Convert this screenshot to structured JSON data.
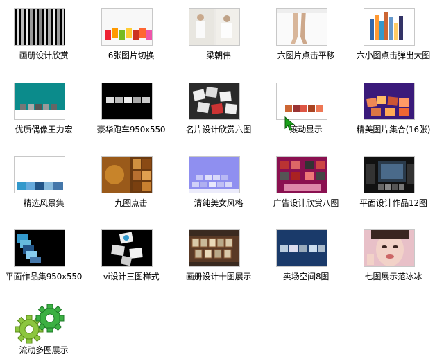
{
  "items": [
    {
      "label": "画册设计欣赏",
      "thumb": "vertical-strips"
    },
    {
      "label": "6张图片切换",
      "thumb": "fruit-strip"
    },
    {
      "label": "梁朝伟",
      "thumb": "people-photo"
    },
    {
      "label": "六图片点击平移",
      "thumb": "legs-photo"
    },
    {
      "label": "六小图点击弹出大图",
      "thumb": "color-bars"
    },
    {
      "label": "优质偶像王力宏",
      "thumb": "teal-banner"
    },
    {
      "label": "豪华跑车950x550",
      "thumb": "dark-thumbs"
    },
    {
      "label": "名片设计欣赏六图",
      "thumb": "scattered-photos"
    },
    {
      "label": "滚动显示",
      "thumb": "scroll-strip"
    },
    {
      "label": "精美图片集合(16张)",
      "thumb": "purple-collection"
    },
    {
      "label": "精选风景集",
      "thumb": "landscape-strip"
    },
    {
      "label": "九图点击",
      "thumb": "nine-grid"
    },
    {
      "label": "清纯美女风格",
      "thumb": "lavender-checker"
    },
    {
      "label": "广告设计欣赏八图",
      "thumb": "magenta-grid"
    },
    {
      "label": "平面设计作品12图",
      "thumb": "dark-gallery"
    },
    {
      "label": "平面作品集950x550",
      "thumb": "blue-stack"
    },
    {
      "label": "vi设计三图样式",
      "thumb": "tilted-photos"
    },
    {
      "label": "画册设计十图展示",
      "thumb": "brown-frames"
    },
    {
      "label": "卖场空间8图",
      "thumb": "navy-strip"
    },
    {
      "label": "七图展示范冰冰",
      "thumb": "portrait-face"
    },
    {
      "label": "流动多图展示",
      "thumb": "gears-icon"
    }
  ]
}
